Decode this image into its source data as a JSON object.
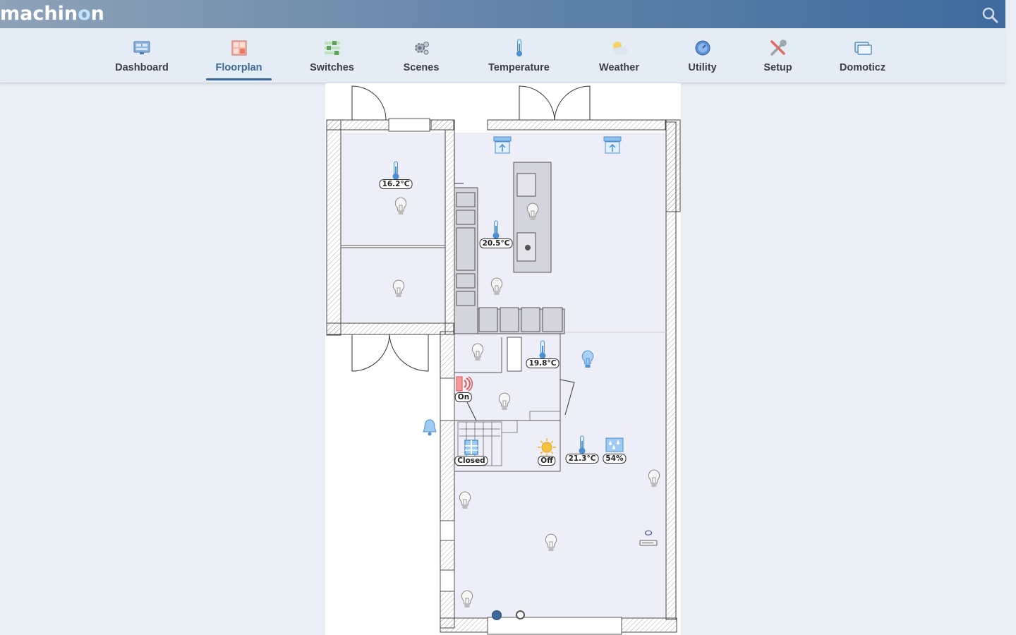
{
  "app": {
    "logo_left": "machin",
    "logo_o": "o",
    "logo_right": "n"
  },
  "nav": {
    "tabs": [
      {
        "label": "Dashboard",
        "icon": "dashboard-icon"
      },
      {
        "label": "Floorplan",
        "icon": "floorplan-icon",
        "active": true
      },
      {
        "label": "Switches",
        "icon": "switches-icon"
      },
      {
        "label": "Scenes",
        "icon": "scenes-icon"
      },
      {
        "label": "Temperature",
        "icon": "thermometer-icon"
      },
      {
        "label": "Weather",
        "icon": "weather-icon"
      },
      {
        "label": "Utility",
        "icon": "utility-icon"
      },
      {
        "label": "Setup",
        "icon": "setup-icon"
      },
      {
        "label": "Domoticz",
        "icon": "domoticz-icon"
      }
    ]
  },
  "floorplan": {
    "temperatures": [
      "16.2°C",
      "20.5°C",
      "19.8°C",
      "21.3°C"
    ],
    "humidity": "54%",
    "siren_status": "On",
    "window_status": "Closed",
    "sun_status": "Off"
  },
  "colors": {
    "accent": "#3d6899",
    "room_fill": "#eeeef9",
    "topbar_start": "#8ea2b8",
    "topbar_end": "#3f6a9f"
  },
  "pager": {
    "pages": 2,
    "current": 1
  }
}
